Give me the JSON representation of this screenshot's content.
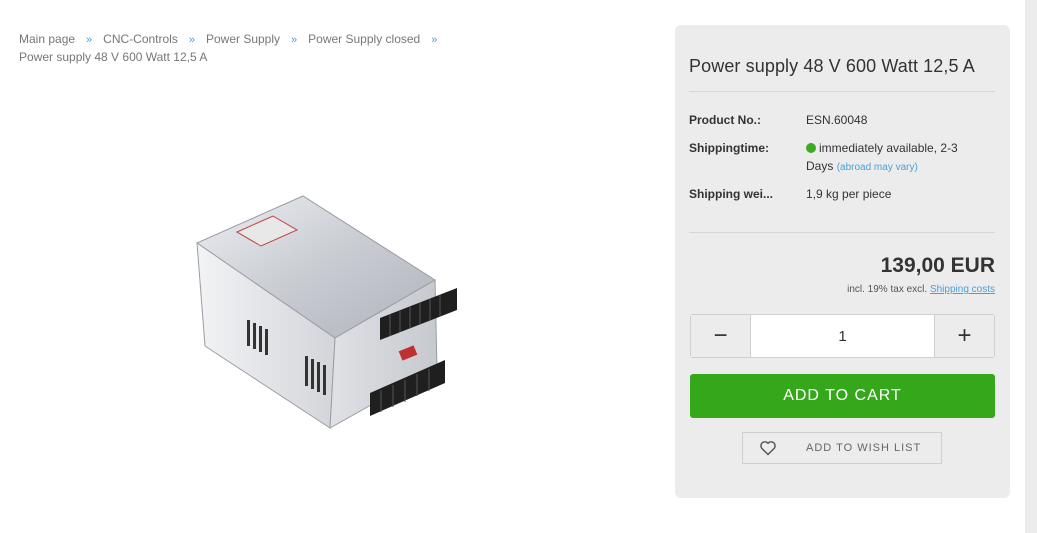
{
  "breadcrumb": {
    "items": [
      "Main page",
      "CNC-Controls",
      "Power Supply",
      "Power Supply closed"
    ],
    "separator": "»",
    "current": "Power supply 48 V 600 Watt 12,5 A"
  },
  "product": {
    "title": "Power supply 48 V 600 Watt 12,5 A",
    "image_icon": "power-supply-unit-image",
    "details": {
      "product_no_label": "Product No.:",
      "product_no_value": "ESN.60048",
      "shipping_time_label": "Shippingtime:",
      "shipping_time_value": "immediately available, 2-3 Days",
      "shipping_time_note": "(abroad may vary)",
      "shipping_weight_label": "Shipping wei...",
      "shipping_weight_value": "1,9 kg per piece"
    },
    "price": "139,00 EUR",
    "tax_text": "incl. 19% tax excl.",
    "shipping_costs_link": "Shipping costs",
    "quantity": "1",
    "minus_label": "−",
    "plus_label": "+",
    "add_to_cart_label": "ADD TO CART",
    "wish_list_label": "ADD TO WISH LIST"
  },
  "colors": {
    "accent": "#34a81a",
    "link": "#4a9fd8",
    "availability": "#3daa26"
  }
}
